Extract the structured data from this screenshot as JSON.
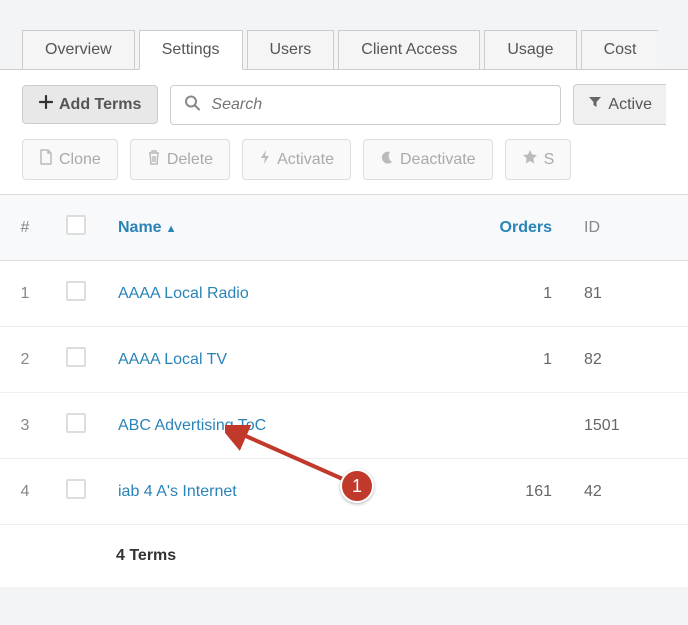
{
  "tabs": {
    "overview": "Overview",
    "settings": "Settings",
    "users": "Users",
    "client_access": "Client Access",
    "usage": "Usage",
    "cost": "Cost"
  },
  "toolbar": {
    "add_terms": "Add Terms",
    "search_placeholder": "Search",
    "filter_active": "Active"
  },
  "actions": {
    "clone": "Clone",
    "delete": "Delete",
    "activate": "Activate",
    "deactivate": "Deactivate",
    "star": "S"
  },
  "table": {
    "headers": {
      "index": "#",
      "name": "Name",
      "orders": "Orders",
      "id": "ID"
    },
    "rows": [
      {
        "index": "1",
        "name": "AAAA Local Radio",
        "orders": "1",
        "id": "81"
      },
      {
        "index": "2",
        "name": "AAAA Local TV",
        "orders": "1",
        "id": "82"
      },
      {
        "index": "3",
        "name": "ABC Advertising ToC",
        "orders": "",
        "id": "1501"
      },
      {
        "index": "4",
        "name": "iab 4 A's Internet",
        "orders": "161",
        "id": "42"
      }
    ]
  },
  "footer": {
    "count": "4 Terms"
  },
  "annotation": {
    "badge": "1"
  }
}
